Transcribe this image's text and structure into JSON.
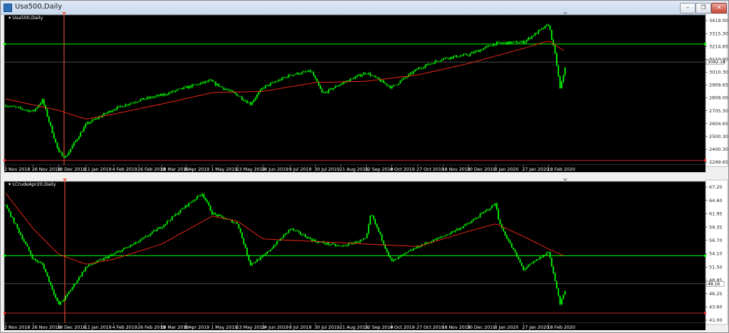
{
  "window": {
    "title": "Usa500,Daily",
    "buttons": [
      "minimize",
      "restore",
      "close"
    ]
  },
  "colors": {
    "background": "#000000",
    "candle": "#00ff00",
    "moving_average": "#ff2a1a",
    "level_line": "#00ff00",
    "vertical_marker": "#ff5a3c",
    "current_price_line": "#9a9a9a",
    "bottom_line": "#ff3030"
  },
  "icons": [
    "window-app-icon",
    "minimize-icon",
    "restore-icon",
    "close-icon",
    "panel-collapse-triangle-icon"
  ],
  "chart_data": [
    {
      "type": "candlestick",
      "title": "Usa500,Daily",
      "y_ticks": [
        "3419.00",
        "3315.30",
        "3214.65",
        "3110.00",
        "3010.30",
        "2909.65",
        "2809.00",
        "2705.30",
        "2604.65",
        "2500.30",
        "2400.30",
        "2299.65"
      ],
      "ylim": [
        2299.65,
        3419.0
      ],
      "current_price": "3092.18",
      "horizontal_level": 3234,
      "bottom_level": 2315,
      "x_ticks": [
        "2 Nov 2018",
        "26 Nov 2018",
        "18 Dec 2018",
        "11 Jan 2019",
        "4 Feb 2019",
        "26 Feb 2019",
        "18 Mar 2019",
        "8 Apr 2019",
        "1 May 2019",
        "23 May 2019",
        "14 Jun 2019",
        "8 Jul 2019",
        "30 Jul 2019",
        "21 Aug 2019",
        "12 Sep 2019",
        "4 Oct 2019",
        "27 Oct 2019",
        "18 Nov 2019",
        "10 Dec 2019",
        "3 Jan 2020",
        "27 Jan 2020",
        "18 Feb 2020"
      ],
      "price_path": [
        [
          "2 Nov 2018",
          2750
        ],
        [
          "26 Nov 2018",
          2700
        ],
        [
          "4 Dec 2018",
          2790
        ],
        [
          "18 Dec 2018",
          2380
        ],
        [
          "24 Dec 2018",
          2340
        ],
        [
          "11 Jan 2019",
          2600
        ],
        [
          "4 Feb 2019",
          2720
        ],
        [
          "26 Feb 2019",
          2790
        ],
        [
          "18 Mar 2019",
          2830
        ],
        [
          "8 Apr 2019",
          2890
        ],
        [
          "30 Apr 2019",
          2945
        ],
        [
          "1 May 2019",
          2930
        ],
        [
          "23 May 2019",
          2830
        ],
        [
          "3 Jun 2019",
          2760
        ],
        [
          "14 Jun 2019",
          2890
        ],
        [
          "8 Jul 2019",
          2990
        ],
        [
          "26 Jul 2019",
          3020
        ],
        [
          "5 Aug 2019",
          2840
        ],
        [
          "21 Aug 2019",
          2920
        ],
        [
          "12 Sep 2019",
          3010
        ],
        [
          "4 Oct 2019",
          2890
        ],
        [
          "27 Oct 2019",
          3040
        ],
        [
          "18 Nov 2019",
          3120
        ],
        [
          "10 Dec 2019",
          3150
        ],
        [
          "3 Jan 2020",
          3240
        ],
        [
          "27 Jan 2020",
          3250
        ],
        [
          "18 Feb 2020",
          3390
        ],
        [
          "24 Feb 2020",
          3130
        ],
        [
          "28 Feb 2020",
          2870
        ],
        [
          "4 Mar 2020",
          3090
        ]
      ],
      "moving_average_path": [
        [
          "2 Nov 2018",
          2800
        ],
        [
          "18 Dec 2018",
          2710
        ],
        [
          "11 Jan 2019",
          2640
        ],
        [
          "4 Feb 2019",
          2680
        ],
        [
          "18 Mar 2019",
          2760
        ],
        [
          "1 May 2019",
          2850
        ],
        [
          "14 Jun 2019",
          2860
        ],
        [
          "30 Jul 2019",
          2930
        ],
        [
          "12 Sep 2019",
          2940
        ],
        [
          "27 Oct 2019",
          2990
        ],
        [
          "10 Dec 2019",
          3080
        ],
        [
          "27 Jan 2020",
          3200
        ],
        [
          "18 Feb 2020",
          3260
        ],
        [
          "4 Mar 2020",
          3170
        ]
      ]
    },
    {
      "type": "candlestick",
      "title": "LCrudeApr20,Daily",
      "y_ticks": [
        "67.20",
        "64.60",
        "61.95",
        "59.35",
        "56.70",
        "54.10",
        "51.50",
        "48.85",
        "46.25",
        "43.60",
        "41.00"
      ],
      "ylim": [
        41.0,
        67.2
      ],
      "current_price": "48.16",
      "horizontal_level": 53.7,
      "bottom_level": 42.4,
      "x_ticks": [
        "2 Nov 2018",
        "26 Nov 2018",
        "18 Dec 2018",
        "11 Jan 2019",
        "4 Feb 2019",
        "26 Feb 2019",
        "18 Mar 2019",
        "8 Apr 2019",
        "1 May 2019",
        "23 May 2019",
        "14 Jun 2019",
        "8 Jul 2019",
        "30 Jul 2019",
        "21 Aug 2019",
        "12 Sep 2019",
        "4 Oct 2019",
        "27 Oct 2019",
        "18 Nov 2019",
        "10 Dec 2019",
        "3 Jan 2020",
        "27 Jan 2020",
        "18 Feb 2020"
      ],
      "price_path": [
        [
          "2 Nov 2018",
          63.5
        ],
        [
          "26 Nov 2018",
          53.0
        ],
        [
          "4 Dec 2018",
          52.0
        ],
        [
          "18 Dec 2018",
          44.0
        ],
        [
          "24 Dec 2018",
          45.5
        ],
        [
          "11 Jan 2019",
          51.5
        ],
        [
          "4 Feb 2019",
          54.0
        ],
        [
          "26 Feb 2019",
          56.5
        ],
        [
          "18 Mar 2019",
          59.5
        ],
        [
          "8 Apr 2019",
          63.5
        ],
        [
          "22 Apr 2019",
          66.0
        ],
        [
          "1 May 2019",
          62.0
        ],
        [
          "23 May 2019",
          60.0
        ],
        [
          "3 Jun 2019",
          52.0
        ],
        [
          "14 Jun 2019",
          53.5
        ],
        [
          "8 Jul 2019",
          59.0
        ],
        [
          "30 Jul 2019",
          56.5
        ],
        [
          "21 Aug 2019",
          55.5
        ],
        [
          "12 Sep 2019",
          57.0
        ],
        [
          "16 Sep 2019",
          62.0
        ],
        [
          "4 Oct 2019",
          52.5
        ],
        [
          "27 Oct 2019",
          55.5
        ],
        [
          "18 Nov 2019",
          57.5
        ],
        [
          "10 Dec 2019",
          60.0
        ],
        [
          "3 Jan 2020",
          64.0
        ],
        [
          "6 Jan 2020",
          60.0
        ],
        [
          "27 Jan 2020",
          51.0
        ],
        [
          "18 Feb 2020",
          54.5
        ],
        [
          "28 Feb 2020",
          44.0
        ],
        [
          "4 Mar 2020",
          47.5
        ]
      ],
      "moving_average_path": [
        [
          "2 Nov 2018",
          66.0
        ],
        [
          "26 Nov 2018",
          59.0
        ],
        [
          "18 Dec 2018",
          54.0
        ],
        [
          "11 Jan 2019",
          52.0
        ],
        [
          "4 Feb 2019",
          53.0
        ],
        [
          "18 Mar 2019",
          56.0
        ],
        [
          "1 May 2019",
          61.5
        ],
        [
          "23 May 2019",
          60.5
        ],
        [
          "14 Jun 2019",
          57.0
        ],
        [
          "30 Jul 2019",
          56.5
        ],
        [
          "12 Sep 2019",
          56.0
        ],
        [
          "27 Oct 2019",
          55.5
        ],
        [
          "10 Dec 2019",
          58.5
        ],
        [
          "3 Jan 2020",
          60.0
        ],
        [
          "27 Jan 2020",
          57.5
        ],
        [
          "18 Feb 2020",
          55.0
        ],
        [
          "4 Mar 2020",
          53.5
        ]
      ]
    }
  ]
}
